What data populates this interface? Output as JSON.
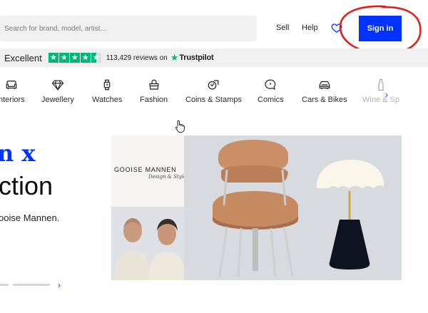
{
  "header": {
    "search_placeholder": "Search for brand, model, artist...",
    "sell_label": "Sell",
    "help_label": "Help",
    "signin_label": "Sign in"
  },
  "trust": {
    "rating_text": "Excellent",
    "reviews_text": "113,429 reviews on",
    "brand": "Trustpilot",
    "stars": 4.5
  },
  "categories": [
    {
      "label": "nteriors",
      "icon": "sofa-icon"
    },
    {
      "label": "Jewellery",
      "icon": "diamond-icon"
    },
    {
      "label": "Watches",
      "icon": "watch-icon"
    },
    {
      "label": "Fashion",
      "icon": "handbag-icon"
    },
    {
      "label": "Coins & Stamps",
      "icon": "coin-stamp-icon"
    },
    {
      "label": "Comics",
      "icon": "speech-bubble-icon"
    },
    {
      "label": "Cars & Bikes",
      "icon": "car-icon"
    },
    {
      "label": "Wine & Sp",
      "icon": "bottle-icon"
    }
  ],
  "hero": {
    "title_line1": "n x",
    "title_line2": "ction",
    "description": "ooise Mannen.",
    "image": {
      "brand_name": "GOOISE MANNEN",
      "brand_script": "Design & Style"
    }
  },
  "colors": {
    "accent": "#0033ff",
    "trustpilot_green": "#00b67a",
    "annotation_red": "#e0201b"
  }
}
